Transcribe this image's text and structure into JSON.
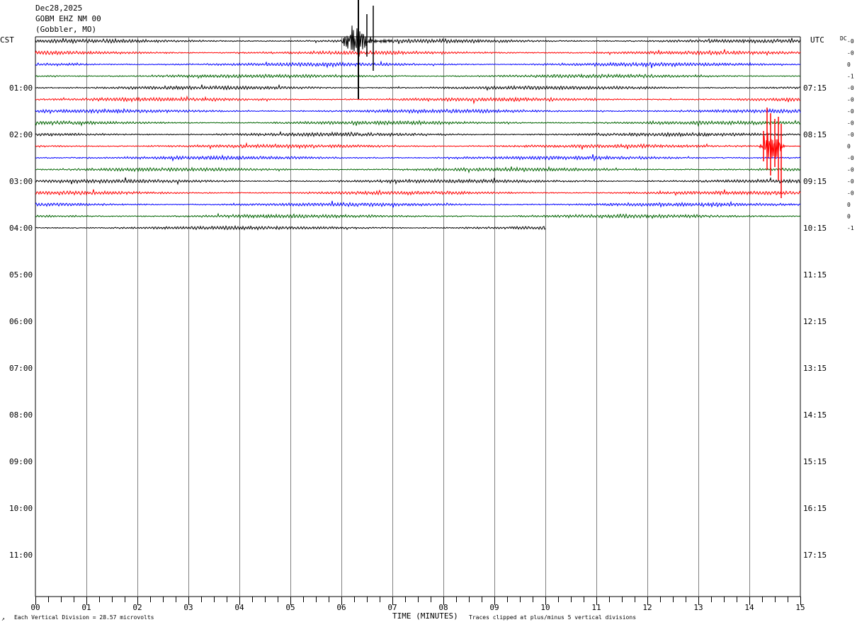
{
  "header": {
    "date": "Dec28,2025",
    "station": "GOBM EHZ NM 00",
    "location": "(Gobbler, MO)"
  },
  "left_tz": "CST",
  "right_tz": "UTC",
  "dc_label": "DC",
  "footer": {
    "left_mark": "↗",
    "division_note": "Each Vertical Division =   28.57 microvolts",
    "xlabel": "TIME (MINUTES)",
    "clip_note": "Traces clipped at plus/minus 5 vertical divisions"
  },
  "colors": {
    "trace_cycle": [
      "#000000",
      "#ff0000",
      "#0000ff",
      "#006400"
    ],
    "grid": "#808080"
  },
  "chart_data": {
    "type": "line",
    "title": "",
    "xlabel": "TIME (MINUTES)",
    "x_ticks": [
      "00",
      "01",
      "02",
      "03",
      "04",
      "05",
      "06",
      "07",
      "08",
      "09",
      "10",
      "11",
      "12",
      "13",
      "14",
      "15"
    ],
    "xlim": [
      0,
      15
    ],
    "minor_tick_step_minutes": 0.25,
    "line_interval_minutes": 15,
    "hour_labels_left": [
      "01:00",
      "02:00",
      "03:00",
      "04:00",
      "05:00",
      "06:00",
      "07:00",
      "08:00",
      "09:00",
      "10:00",
      "11:00"
    ],
    "hour_labels_right": [
      "07:15",
      "08:15",
      "09:15",
      "10:15",
      "11:15",
      "12:15",
      "13:15",
      "14:15",
      "15:15",
      "16:15",
      "17:15"
    ],
    "traces_drawn": 17,
    "last_trace_end_minute": 10,
    "dc_offsets": [
      "-0",
      "-0",
      "0",
      "-1",
      "-0",
      "-0",
      "-0",
      "-0",
      "-0",
      "0",
      "-0",
      "-0",
      "-0",
      "-0",
      "0",
      "0",
      "-1"
    ],
    "events": [
      {
        "trace": 0,
        "start_minute": 6.0,
        "end_minute": 7.0,
        "color": "black"
      },
      {
        "trace": 9,
        "start_minute": 14.2,
        "end_minute": 15.0,
        "color": "red"
      }
    ]
  }
}
